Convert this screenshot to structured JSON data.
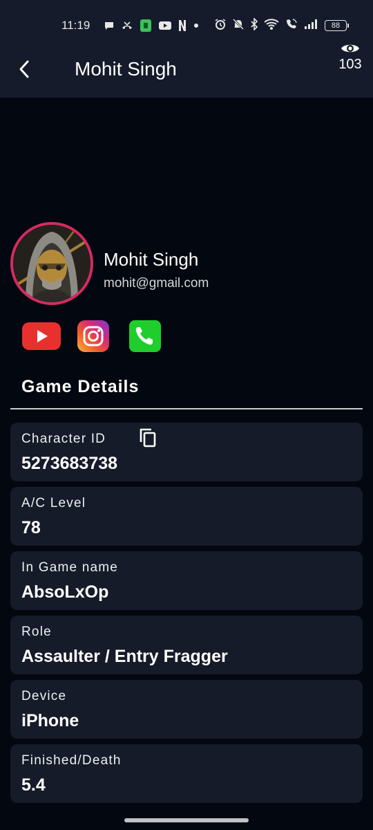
{
  "status_bar": {
    "time": "11:19",
    "battery": "88",
    "icons": [
      "chat-icon",
      "missed-call-icon",
      "app-icon",
      "youtube-icon",
      "netflix-icon",
      "dot-icon",
      "alarm-icon",
      "mute-icon",
      "bluetooth-icon",
      "wifi-icon",
      "wifi-call-icon",
      "signal-icon",
      "battery-icon"
    ]
  },
  "app_bar": {
    "title": "Mohit Singh",
    "view_count": "103",
    "back_icon": "chevron-left-icon",
    "views_icon": "eye-icon"
  },
  "profile": {
    "name": "Mohit Singh",
    "email": "mohit@gmail.com",
    "avatar_ring_color": "#d62a62"
  },
  "social": [
    {
      "name": "youtube",
      "color": "#e8312f"
    },
    {
      "name": "instagram",
      "color": "#d62976"
    },
    {
      "name": "phone",
      "color": "#1fce2c"
    }
  ],
  "section": {
    "title": "Game Details"
  },
  "details": [
    {
      "label": "Character ID",
      "value": "5273683738",
      "copyable": true
    },
    {
      "label": "A/C Level",
      "value": "78"
    },
    {
      "label": "In Game name",
      "value": "AbsoLxOp"
    },
    {
      "label": "Role",
      "value": "Assaulter / Entry Fragger"
    },
    {
      "label": "Device",
      "value": "iPhone"
    },
    {
      "label": "Finished/Death",
      "value": "5.4"
    }
  ],
  "colors": {
    "background": "#03070f",
    "header": "#151b2a",
    "card": "#151b28"
  }
}
